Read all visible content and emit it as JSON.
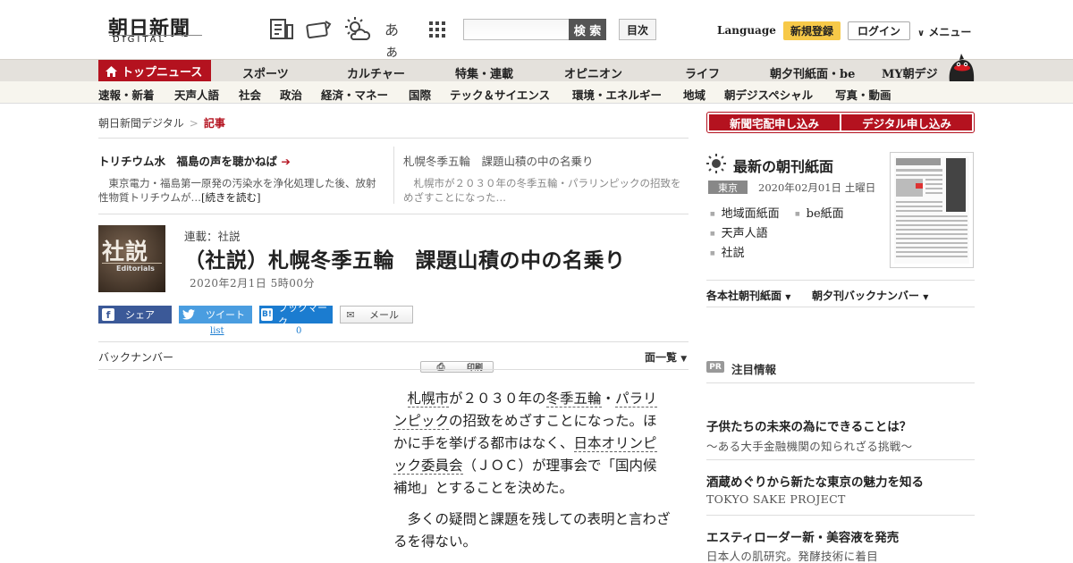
{
  "header": {
    "logo_jp": "朝日新聞",
    "logo_en": "DIGITAL",
    "font_size_icon_label": "あぁ",
    "search_placeholder": "",
    "search_button": "検 索",
    "contents_button": "目次",
    "language": "Language",
    "register": "新規登録",
    "login": "ログイン",
    "menu": "メニュー"
  },
  "nav_primary": {
    "active": "トップニュース",
    "items": [
      "スポーツ",
      "カルチャー",
      "特集・連載",
      "オピニオン",
      "ライフ",
      "朝夕刊紙面・be",
      "MY朝デジ"
    ]
  },
  "nav_secondary": {
    "items": [
      "速報・新着",
      "天声人語",
      "社会",
      "政治",
      "経済・マネー",
      "国際",
      "テック＆サイエンス",
      "環境・エネルギー",
      "地域",
      "朝デジスペシャル",
      "写真・動画"
    ]
  },
  "breadcrumb": {
    "home": "朝日新聞デジタル",
    "sep": ">",
    "current": "記事"
  },
  "picks": [
    {
      "title": "トリチウム水　福島の声を聴かねば",
      "arrow": "➔",
      "desc": "東京電力・福島第一原発の汚染水を浄化処理した後、放射性物質トリチウムが…",
      "more": "[続きを読む]"
    },
    {
      "title": "札幌冬季五輪　課題山積の中の名乗り",
      "desc": "札幌市が２０３０年の冬季五輪・パラリンピックの招致をめざすことになった…"
    }
  ],
  "article": {
    "badge_jp": "社説",
    "badge_en": "Editorials",
    "series": "連載：社説",
    "title": "（社説）札幌冬季五輪　課題山積の中の名乗り",
    "date": "2020年2月1日 5時00分",
    "share": {
      "facebook": "シェア",
      "twitter": "ツイート",
      "hatena": "ブックマーク",
      "mail": "メール",
      "print": "印刷",
      "twitter_count": "list",
      "hatena_count": "0"
    },
    "back_number": "バックナンバー",
    "page_list": "面一覧",
    "para1_parts": [
      {
        "t": "札幌市",
        "kw": true
      },
      {
        "t": "が２０３０年の",
        "kw": false
      },
      {
        "t": "冬季五輪",
        "kw": true
      },
      {
        "t": "・",
        "kw": false
      },
      {
        "t": "パラリンピック",
        "kw": true
      },
      {
        "t": "の招致をめざすことになった。ほかに手を挙げる都市はなく、",
        "kw": false
      },
      {
        "t": "日本オリンピック委員会",
        "kw": true
      },
      {
        "t": "（ＪＯＣ）が理事会で「国内候補地」とすることを決めた。",
        "kw": false
      }
    ],
    "para2": "多くの疑問と課題を残しての表明と言わざるを得ない。"
  },
  "sidebar": {
    "btn_home": "新聞宅配申し込み",
    "btn_digital": "デジタル申し込み",
    "latest_title": "最新の朝刊紙面",
    "region_tag": "東京",
    "issue_date": "2020年02月01日 土曜日",
    "links": [
      "地域面紙面",
      "be紙面",
      "天声人語",
      "社説"
    ],
    "dropdown1": "各本社朝刊紙面",
    "dropdown2": "朝夕刊バックナンバー",
    "pr_badge": "PR",
    "pr_title": "注目情報",
    "ads": [
      {
        "title": "子供たちの未来の為にできることは？",
        "sub": "～ある大手金融機関の知られざる挑戦～"
      },
      {
        "title": "酒蔵めぐりから新たな東京の魅力を知る",
        "sub": "TOKYO SAKE PROJECT"
      },
      {
        "title": "エスティローダー新・美容液を発売",
        "sub": "日本人の肌研究。発酵技術に着目"
      }
    ]
  },
  "colors": {
    "brand_red": "#b4121f",
    "facebook": "#3b5998",
    "twitter": "#4a9de0",
    "hatena": "#1b7cd0",
    "register_yellow": "#f7c948"
  }
}
